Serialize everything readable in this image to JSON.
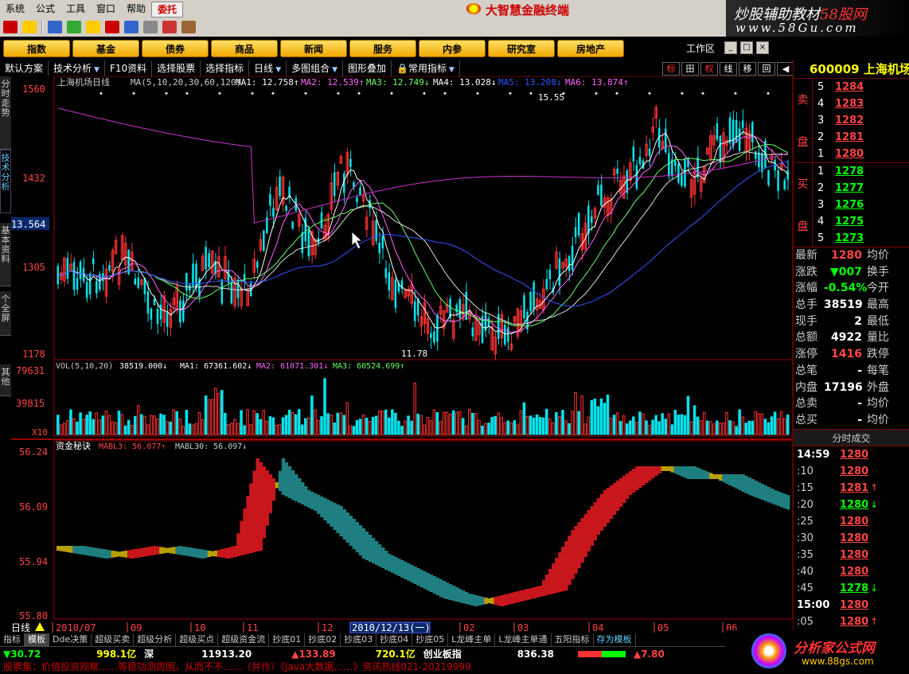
{
  "menubar": {
    "items": [
      "系统",
      "公式",
      "工具",
      "窗口",
      "帮助",
      "委托"
    ],
    "app_title": "大智慧金融终端"
  },
  "banner": {
    "line1_a": "炒股辅助教材",
    "line1_b": "58股网",
    "line2": "www.58Gu.com"
  },
  "navbar": {
    "buttons": [
      "指数",
      "基金",
      "债券",
      "商品",
      "新闻",
      "服务",
      "内参",
      "研究室",
      "房地产"
    ],
    "workarea": "工作区"
  },
  "chart_toolbar": {
    "items": [
      "默认方案",
      "技术分析",
      "F10资料",
      "选择股票",
      "选择指标",
      "日线",
      "多图组合",
      "图形叠加",
      "常用指标"
    ],
    "right_buttons": [
      "标",
      "田",
      "权",
      "线",
      "移",
      "回",
      "◀"
    ]
  },
  "vtabs": [
    "分时走势",
    "技术分析",
    "基本资料",
    "个全屏",
    "其他"
  ],
  "price_panel": {
    "title": "上海机场日线",
    "ma_header": "MA(5,10,20,30,60,120)",
    "ma_values": [
      "MA1: 12.758↑",
      "MA2: 12.539↑",
      "MA3: 12.749↓",
      "MA4: 13.028↓",
      "MA5: 13.208↓",
      "MA6: 13.874↑"
    ],
    "ma_colors": [
      "#ffffff",
      "#ff66ff",
      "#66ff66",
      "#ffffff",
      "#3355ff",
      "#ff66ff"
    ],
    "y_ticks": [
      "1560",
      "1432",
      "1305",
      "1178"
    ],
    "cursor_price": "13.564",
    "high_label": "15.55",
    "low_label": "11.78"
  },
  "volume_panel": {
    "header": "VOL(5,10,20)",
    "value": "38519.000↓",
    "ma_values": [
      "MA1: 67361.602↓",
      "MA2: 61071.301↓",
      "MA3: 60524.699↑"
    ],
    "y_ticks": [
      "79631",
      "39815"
    ],
    "multiplier": "X10"
  },
  "indicator_panel": {
    "name": "资金秘诀",
    "ma_values": [
      "MABL3: 56.077↑",
      "MABL30: 56.097↓"
    ],
    "y_ticks": [
      "56.24",
      "56.09",
      "55.94",
      "55.80"
    ]
  },
  "x_axis": {
    "labels": [
      "2010/07",
      "09",
      "10",
      "11",
      "12",
      "2010/12/13(一)",
      "02",
      "03",
      "04",
      "05",
      "06"
    ],
    "period": "日线"
  },
  "bottom_tabs": [
    "指标",
    "模板",
    "Dde决策",
    "超级买卖",
    "超级分析",
    "超级买点",
    "超级资金流",
    "抄底01",
    "抄底02",
    "抄底03",
    "抄底04",
    "抄底05",
    "L龙峰主单",
    "L龙峰主单通",
    "五阳指标",
    "存为模板"
  ],
  "status": {
    "sh_change": "▼30.72",
    "sh_amount": "998.1亿",
    "sz_label": "深",
    "sz_index": "11913.20",
    "sz_change": "▲133.89",
    "sz_amount": "720.1亿",
    "cyb_label": "创业板指",
    "cyb_index": "836.38",
    "cyb_change": "▲7.80"
  },
  "ticker": "股票集：价值投资观察……等稳功测周围，从而不不……（并作）《Java大数据……》资讯热线021-20219999",
  "right_panel": {
    "code": "600009",
    "name": "上海机场",
    "sell_label": [
      "卖",
      "盘"
    ],
    "buy_label": [
      "买",
      "盘"
    ],
    "sell": [
      {
        "lvl": "5",
        "px": "1284"
      },
      {
        "lvl": "4",
        "px": "1283"
      },
      {
        "lvl": "3",
        "px": "1282"
      },
      {
        "lvl": "2",
        "px": "1281"
      },
      {
        "lvl": "1",
        "px": "1280"
      }
    ],
    "buy": [
      {
        "lvl": "1",
        "px": "1278"
      },
      {
        "lvl": "2",
        "px": "1277"
      },
      {
        "lvl": "3",
        "px": "1276"
      },
      {
        "lvl": "4",
        "px": "1275"
      },
      {
        "lvl": "5",
        "px": "1273"
      }
    ],
    "stats": [
      {
        "label": "最新",
        "value": "1280",
        "label2": "均价",
        "color": "#f44"
      },
      {
        "label": "涨跌",
        "value": "▼007",
        "label2": "换手",
        "color": "#0f0"
      },
      {
        "label": "涨幅",
        "value": "-0.54%",
        "label2": "今开",
        "color": "#0f0"
      },
      {
        "label": "总手",
        "value": "38519",
        "label2": "最高",
        "color": "#fff"
      },
      {
        "label": "现手",
        "value": "2",
        "label2": "最低",
        "color": "#fff"
      },
      {
        "label": "总额",
        "value": "4922",
        "label2": "量比",
        "color": "#fff"
      },
      {
        "label": "涨停",
        "value": "1416",
        "label2": "跌停",
        "color": "#f44"
      },
      {
        "label": "总笔",
        "value": "-",
        "label2": "每笔",
        "color": "#fff"
      },
      {
        "label": "内盘",
        "value": "17196",
        "label2": "外盘",
        "color": "#fff"
      },
      {
        "label": "总卖",
        "value": "-",
        "label2": "均价",
        "color": "#fff"
      },
      {
        "label": "总买",
        "value": "-",
        "label2": "均价",
        "color": "#fff"
      }
    ],
    "ticks_header": "分时成交",
    "ticks": [
      {
        "t": "14:59",
        "p": "1280",
        "a": "",
        "big": true,
        "green": false
      },
      {
        "t": ":10",
        "p": "1280",
        "a": "",
        "big": false,
        "green": false
      },
      {
        "t": ":15",
        "p": "1281",
        "a": "↑",
        "big": false,
        "green": false
      },
      {
        "t": ":20",
        "p": "1280",
        "a": "↓",
        "big": false,
        "green": true
      },
      {
        "t": ":25",
        "p": "1280",
        "a": "",
        "big": false,
        "green": false
      },
      {
        "t": ":30",
        "p": "1280",
        "a": "",
        "big": false,
        "green": false
      },
      {
        "t": ":35",
        "p": "1280",
        "a": "",
        "big": false,
        "green": false
      },
      {
        "t": ":40",
        "p": "1280",
        "a": "",
        "big": false,
        "green": false
      },
      {
        "t": ":45",
        "p": "1278",
        "a": "↓",
        "big": false,
        "green": true
      },
      {
        "t": "15:00",
        "p": "1280",
        "a": "",
        "big": true,
        "green": false
      },
      {
        "t": ":05",
        "p": "1280",
        "a": "↑",
        "big": false,
        "green": false
      }
    ]
  },
  "brand2": {
    "t1": "分析家公式网",
    "t2": "www.88gs.com"
  },
  "colors": {
    "up": "#ff3333",
    "down": "#00ffff",
    "bg": "#000000",
    "frame": "#990000",
    "indicator_up": "#c8161d",
    "indicator_down": "#1f7f80",
    "indicator_mid": "#b8a000"
  }
}
